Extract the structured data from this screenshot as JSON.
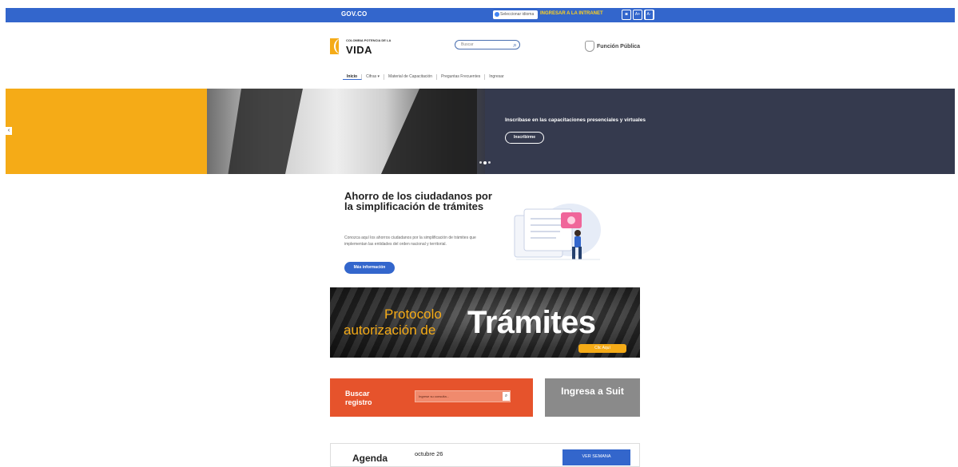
{
  "gov_bar": {
    "logo": "GOV.CO",
    "language_select": "Seleccionar idioma",
    "intranet_link": "INGRESAR A LA INTRANET",
    "buttons": [
      "rss",
      "A+",
      "A-",
      "contrast"
    ]
  },
  "header": {
    "logo_small": "COLOMBIA POTENCIA DE LA",
    "logo_main": "VIDA",
    "search_placeholder": "Buscar",
    "entity_name": "Función Pública"
  },
  "nav": {
    "items": [
      "Inicio",
      "Cifras",
      "Material de Capacitación",
      "Preguntas Frecuentes",
      "Ingresar"
    ],
    "cifras_caret": "▾"
  },
  "hero": {
    "title": "Inscríbase en las capacitaciones presenciales y virtuales",
    "button": "Inscribirme",
    "prev_arrow": "‹"
  },
  "ahorro": {
    "title": "Ahorro de los ciudadanos por la simplificación de trámites",
    "description": "Conozca aquí los ahorros ciudadanos por la simplificación de trámites que implementan las entidades del orden nacional y territorial.",
    "button": "Más información"
  },
  "protocolo": {
    "line1": "Protocolo",
    "line2": "autorización de",
    "big": "Trámites",
    "button": "Clic Aquí"
  },
  "buscar_registro": {
    "title_line1": "Buscar",
    "title_line2": "registro",
    "input_placeholder": "Ingrese su consulta..."
  },
  "suit": {
    "label": "Ingresa a Suit"
  },
  "agenda": {
    "title": "Agenda",
    "date": "octubre 26",
    "button": "VER SEMANA"
  },
  "colors": {
    "gov_blue": "#3366cc",
    "brand_yellow": "#f5ab17",
    "buscar_orange": "#e6532c",
    "suit_gray": "#8a8a8a"
  }
}
